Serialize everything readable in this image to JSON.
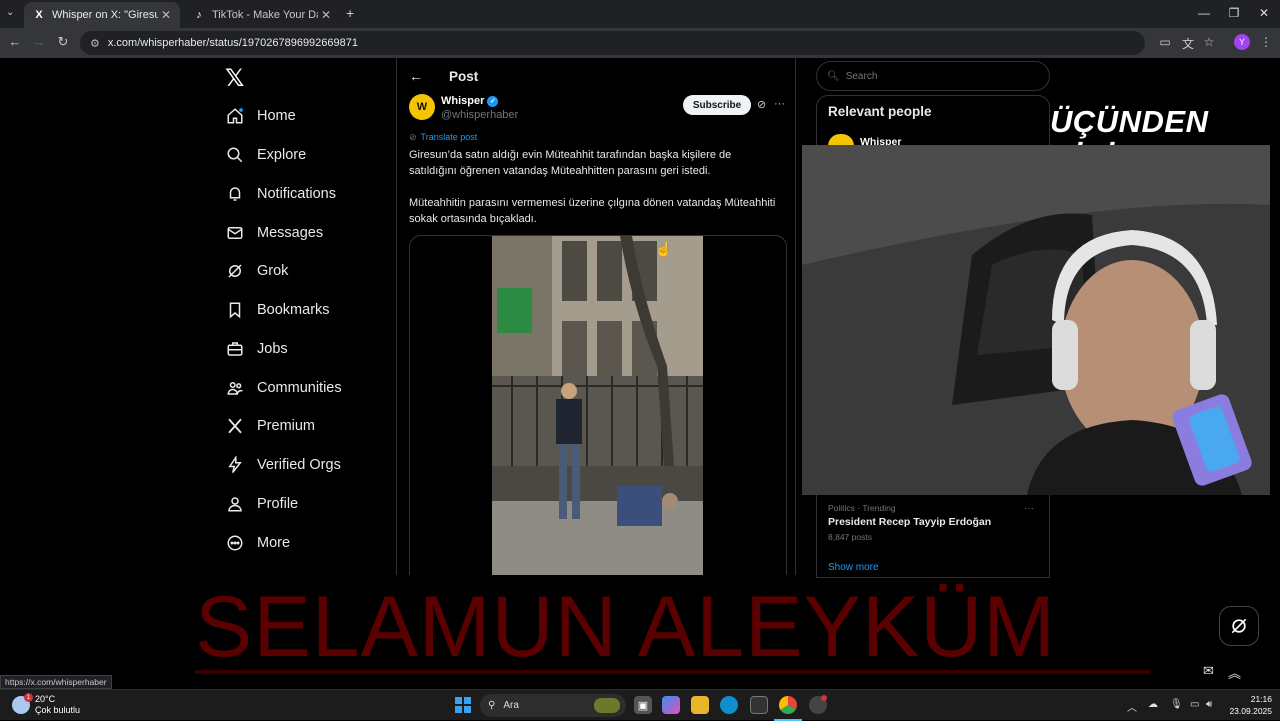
{
  "browser": {
    "tabs": [
      {
        "title": "Whisper on X: \"Giresun'da satın",
        "favicon": "X",
        "active": true
      },
      {
        "title": "TikTok - Make Your Day",
        "favicon": "♪",
        "active": false
      }
    ],
    "new_tab": "+",
    "url": "x.com/whisperhaber/status/1970267896992669871",
    "profile_initial": "Y",
    "status_url": "https://x.com/whisperhaber"
  },
  "nav": {
    "logo": "𝕏",
    "items": [
      {
        "label": "Home",
        "icon": "home-icon"
      },
      {
        "label": "Explore",
        "icon": "search-icon"
      },
      {
        "label": "Notifications",
        "icon": "bell-icon"
      },
      {
        "label": "Messages",
        "icon": "mail-icon"
      },
      {
        "label": "Grok",
        "icon": "grok-icon"
      },
      {
        "label": "Bookmarks",
        "icon": "bookmark-icon"
      },
      {
        "label": "Jobs",
        "icon": "briefcase-icon"
      },
      {
        "label": "Communities",
        "icon": "people-icon"
      },
      {
        "label": "Premium",
        "icon": "x-premium-icon"
      },
      {
        "label": "Verified Orgs",
        "icon": "lightning-icon"
      },
      {
        "label": "Profile",
        "icon": "person-icon"
      },
      {
        "label": "More",
        "icon": "more-circle-icon"
      }
    ]
  },
  "post": {
    "header": "Post",
    "author_name": "Whisper",
    "author_handle": "@whisperhaber",
    "avatar_text": "W",
    "subscribe_label": "Subscribe",
    "translate_label": "Translate post",
    "paragraph1": "Giresun’da satın aldığı evin Müteahhit tarafından başka kişilere de satıldığını öğrenen vatandaş Müteahhitten parasını geri istedi.",
    "paragraph2": "Müteahhitin parasını vermemesi üzerine çılgına dönen vatandaş Müteahhiti sokak ortasında bıçakladı."
  },
  "sidebar": {
    "search_placeholder": "Search",
    "relevant_title": "Relevant people",
    "relevant_person": "Whisper",
    "trend": {
      "meta": "Politics · Trending",
      "title": "President Recep Tayyip Erdoğan",
      "count": "8,847 posts"
    },
    "show_more": "Show more"
  },
  "overlay": {
    "top_text": "ÜÇÜNDEN BİRİ",
    "big_text": "SELAMUN ALEYKÜM"
  },
  "taskbar": {
    "temperature": "20°C",
    "weather_desc": "Çok bulutlu",
    "weather_badge": "1",
    "search_label": "Ara",
    "time": "21:16",
    "date": "23.09.2025"
  }
}
